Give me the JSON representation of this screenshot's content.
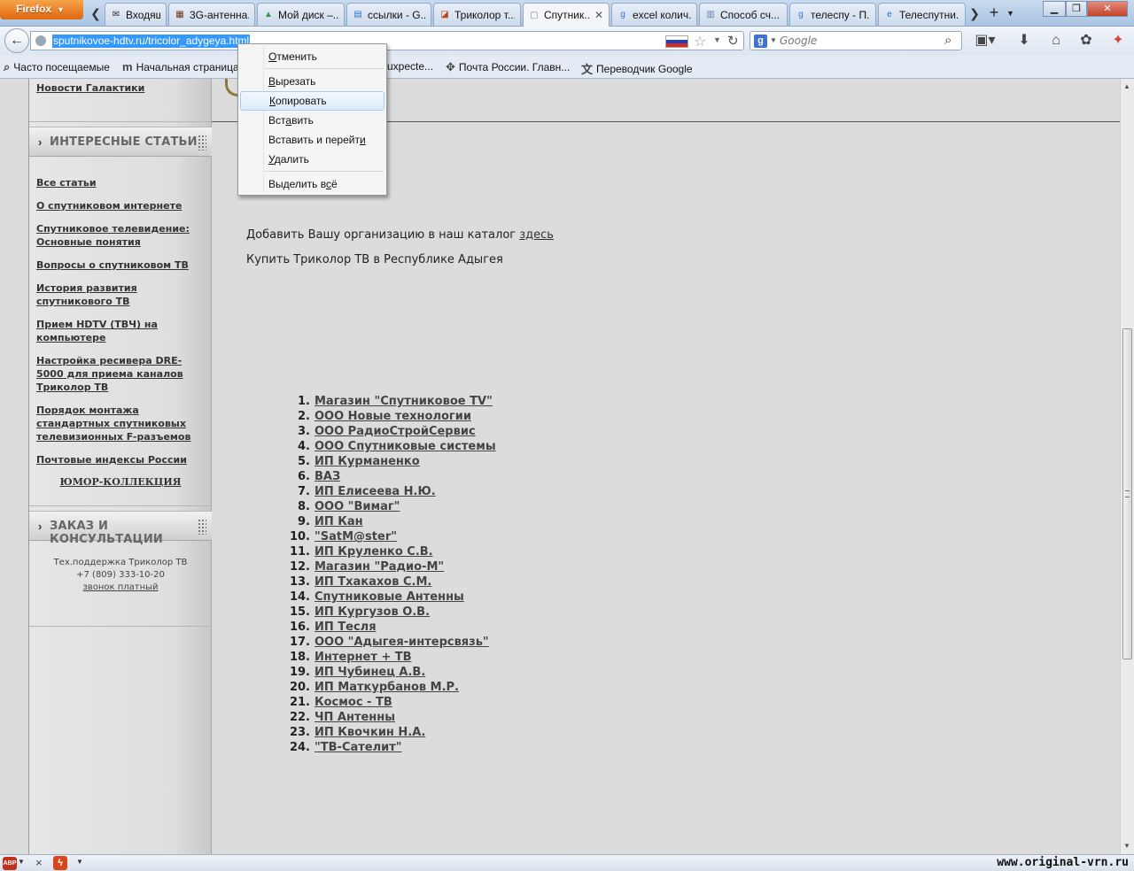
{
  "browser": {
    "app_button_label": "Firefox",
    "tabs": [
      {
        "label": "Входящи...",
        "icon": "mail-icon",
        "active": false
      },
      {
        "label": "3G-антенна...",
        "icon": "antenna-site-icon",
        "active": false
      },
      {
        "label": "Мой диск –...",
        "icon": "google-drive-icon",
        "active": false
      },
      {
        "label": "ссылки - G...",
        "icon": "google-docs-icon",
        "active": false
      },
      {
        "label": "Триколор т...",
        "icon": "tricolor-site-icon",
        "active": false
      },
      {
        "label": "Спутник...",
        "icon": "blank-page-icon",
        "active": true
      },
      {
        "label": "excel колич...",
        "icon": "google-search-icon",
        "active": false
      },
      {
        "label": "Способ сч...",
        "icon": "document-icon",
        "active": false
      },
      {
        "label": "телеспу - П...",
        "icon": "google-search-icon",
        "active": false
      },
      {
        "label": "Телеспутни...",
        "icon": "ie-page-icon",
        "active": false
      }
    ],
    "url": "sputnikovoe-hdtv.ru/tricolor_adygeya.html",
    "search_placeholder": "Google",
    "bookmarks": [
      {
        "label": "Часто посещаемые",
        "icon": "most-visited-icon"
      },
      {
        "label": "Начальная страница",
        "icon": "m-logo-icon"
      },
      {
        "label": "uxpecte...",
        "icon": "bookmark-icon"
      },
      {
        "label": "Почта России. Главн...",
        "icon": "eagle-emblem-icon"
      },
      {
        "label": "Переводчик Google",
        "icon": "google-translate-icon"
      }
    ]
  },
  "context_menu": {
    "items": [
      {
        "label_pre": "",
        "accel": "О",
        "label_post": "тменить",
        "highlighted": false
      },
      {
        "label_pre": "",
        "accel": "В",
        "label_post": "ырезать",
        "highlighted": false
      },
      {
        "label_pre": "",
        "accel": "К",
        "label_post": "опировать",
        "highlighted": true
      },
      {
        "label_pre": "Вст",
        "accel": "а",
        "label_post": "вить",
        "highlighted": false
      },
      {
        "label_pre": "Вставить и перейт",
        "accel": "и",
        "label_post": "",
        "highlighted": false
      },
      {
        "label_pre": "",
        "accel": "У",
        "label_post": "далить",
        "highlighted": false
      },
      {
        "label_pre": "Выделить в",
        "accel": "с",
        "label_post": "ё",
        "highlighted": false
      }
    ]
  },
  "sidebar": {
    "top_link": "Новости Галактики",
    "articles_header": "ИНТЕРЕСНЫЕ СТАТЬИ",
    "articles": [
      "Все статьи",
      "О спутниковом интернете",
      "Спутниковое телевидение: Основные понятия",
      "Вопросы о спутниковом ТВ",
      "История развития спутникового ТВ",
      "Прием HDTV (ТВЧ) на компьютере",
      "Настройка ресивера DRE-5000 для приема каналов Триколор ТВ",
      "Порядок монтажа стандартных спутниковых телевизионных F-разъемов",
      "Почтовые индексы России"
    ],
    "humor_link": "ЮМОР-КОЛЛЕКЦИЯ",
    "order_header": "ЗАКАЗ И КОНСУЛЬТАЦИИ",
    "support_title": "Тех.поддержка Триколор ТВ",
    "support_phone": "+7 (809) 333-10-20",
    "support_note": "звонок платный"
  },
  "content": {
    "add_org_text": "Добавить Вашу организацию в наш каталог ",
    "add_org_link": "здесь",
    "buy_text": "Купить Триколор ТВ в Республике Адыгея",
    "dealers": [
      "Магазин \"Спутниковое TV\"",
      "ООО  Новые технологии",
      "ООО РадиоСтройСервис",
      "ООО Спутниковые системы",
      "ИП Курманенко",
      "ВАЗ",
      "ИП Елисеева Н.Ю.",
      "ООО \"Вимаг\"",
      "ИП Кан",
      "\"SatM@ster\"",
      "ИП Круленко С.В.",
      "Магазин \"Радио-М\"",
      "ИП Тхакахов С.М.",
      "Спутниковые Антенны",
      "ИП Кургузов О.В.",
      "ИП Тесля",
      "ООО \"Адыгея-интерсвязь\"",
      "Интернет + ТВ",
      "ИП Чубинец А.В.",
      "ИП Маткурбанов М.Р.",
      "Космос - ТВ",
      "ЧП Антенны",
      "ИП Квочкин Н.А.",
      "\"ТВ-Сателит\""
    ]
  },
  "statusbar": {
    "watermark": "www.original-vrn.ru"
  },
  "colors": {
    "url_selection": "#3399ff",
    "menu_highlight": "#dcebfc",
    "page_background": "#dcdcdc"
  }
}
